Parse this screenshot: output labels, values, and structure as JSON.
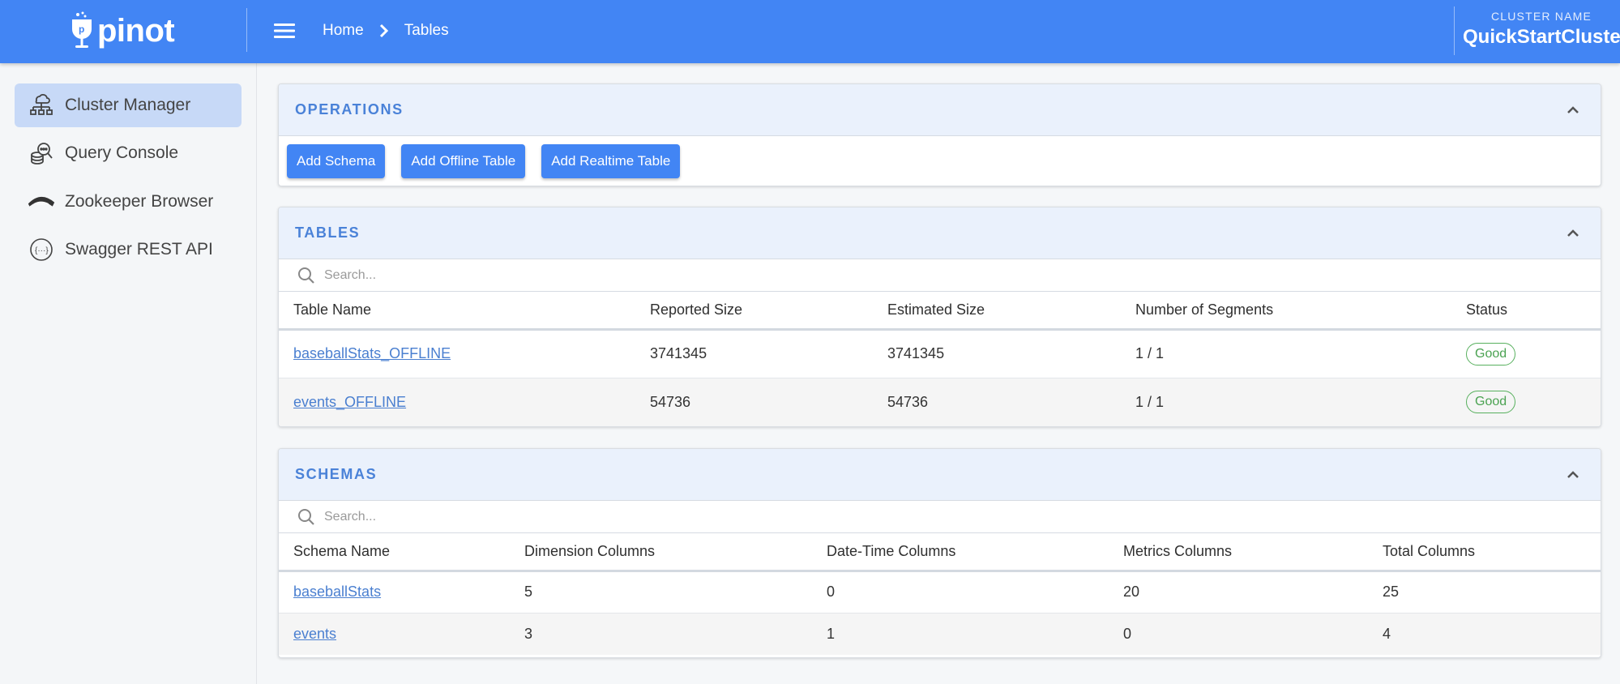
{
  "header": {
    "logo_text": "pinot",
    "breadcrumb": [
      "Home",
      "Tables"
    ],
    "cluster_label": "CLUSTER NAME",
    "cluster_name": "QuickStartCluster",
    "brand_color": "#4285f4"
  },
  "sidebar": {
    "items": [
      {
        "label": "Cluster Manager",
        "icon": "cluster-icon",
        "active": true
      },
      {
        "label": "Query Console",
        "icon": "query-icon",
        "active": false
      },
      {
        "label": "Zookeeper Browser",
        "icon": "zookeeper-icon",
        "active": false
      },
      {
        "label": "Swagger REST API",
        "icon": "api-icon",
        "active": false
      }
    ]
  },
  "operations": {
    "title": "OPERATIONS",
    "buttons": [
      "Add Schema",
      "Add Offline Table",
      "Add Realtime Table"
    ]
  },
  "tables": {
    "title": "TABLES",
    "search_placeholder": "Search...",
    "columns": [
      "Table Name",
      "Reported Size",
      "Estimated Size",
      "Number of Segments",
      "Status"
    ],
    "rows": [
      {
        "name": "baseballStats_OFFLINE",
        "reported": "3741345",
        "estimated": "3741345",
        "segments": "1 / 1",
        "status": "Good"
      },
      {
        "name": "events_OFFLINE",
        "reported": "54736",
        "estimated": "54736",
        "segments": "1 / 1",
        "status": "Good"
      }
    ]
  },
  "schemas": {
    "title": "SCHEMAS",
    "search_placeholder": "Search...",
    "columns": [
      "Schema Name",
      "Dimension Columns",
      "Date-Time Columns",
      "Metrics Columns",
      "Total Columns"
    ],
    "rows": [
      {
        "name": "baseballStats",
        "dimension": "5",
        "datetime": "0",
        "metrics": "20",
        "total": "25"
      },
      {
        "name": "events",
        "dimension": "3",
        "datetime": "1",
        "metrics": "0",
        "total": "4"
      }
    ]
  }
}
